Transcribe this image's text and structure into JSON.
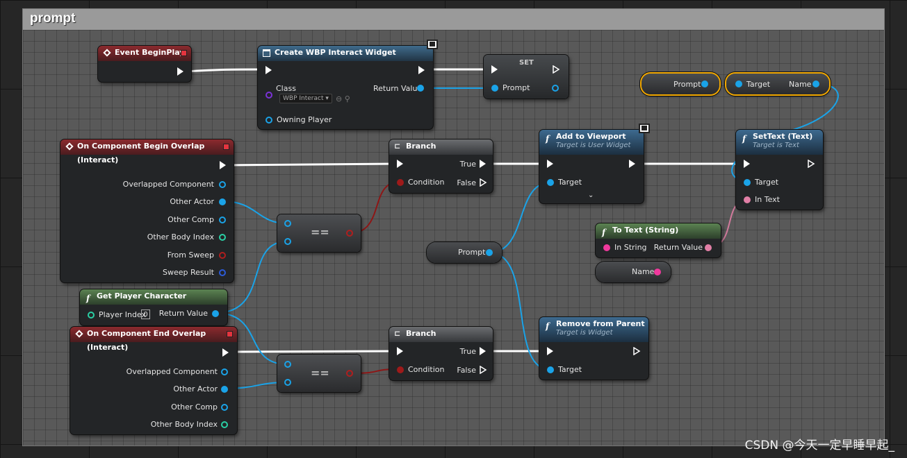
{
  "comment": {
    "title": "prompt"
  },
  "nodes": {
    "event_begin_play": {
      "title": "Event BeginPlay"
    },
    "create_widget": {
      "title": "Create WBP Interact Widget",
      "class_label": "Class",
      "class_value": "WBP Interact",
      "return_label": "Return Value",
      "owning_label": "Owning Player"
    },
    "set_node": {
      "title": "SET",
      "prompt_label": "Prompt"
    },
    "prompt_var_top": {
      "label": "Prompt"
    },
    "target_name": {
      "target_label": "Target",
      "name_label": "Name"
    },
    "begin_overlap": {
      "title": "On Component Begin Overlap (Interact)",
      "pins": [
        "Overlapped Component",
        "Other Actor",
        "Other Comp",
        "Other Body Index",
        "From Sweep",
        "Sweep Result"
      ]
    },
    "branch1": {
      "title": "Branch",
      "true_label": "True",
      "condition_label": "Condition",
      "false_label": "False"
    },
    "add_viewport": {
      "title": "Add to Viewport",
      "subtitle": "Target is User Widget",
      "target_label": "Target"
    },
    "settext": {
      "title": "SetText (Text)",
      "subtitle": "Target is Text",
      "target_label": "Target",
      "intext_label": "In Text"
    },
    "eq1": {
      "label": "=="
    },
    "prompt_var_mid": {
      "label": "Prompt"
    },
    "to_text": {
      "title": "To Text (String)",
      "in_label": "In String",
      "return_label": "Return Value"
    },
    "name_var": {
      "label": "Name"
    },
    "get_player": {
      "title": "Get Player Character",
      "index_label": "Player Index",
      "index_value": "0",
      "return_label": "Return Value"
    },
    "end_overlap": {
      "title": "On Component End Overlap (Interact)",
      "pins": [
        "Overlapped Component",
        "Other Actor",
        "Other Comp",
        "Other Body Index"
      ]
    },
    "branch2": {
      "title": "Branch",
      "true_label": "True",
      "condition_label": "Condition",
      "false_label": "False"
    },
    "remove_parent": {
      "title": "Remove from Parent",
      "subtitle": "Target is Widget",
      "target_label": "Target"
    },
    "eq2": {
      "label": "=="
    }
  },
  "watermark": "CSDN @今天一定早睡早起_",
  "colors": {
    "exec": "#ffffff",
    "object": "#1aa3e8",
    "bool": "#9e1a1a",
    "string": "#f0399d",
    "text": "#e17fa6",
    "event_head": "#8b2a2e",
    "function_head": "#3f6b8c",
    "pure_head": "#5b8352"
  }
}
